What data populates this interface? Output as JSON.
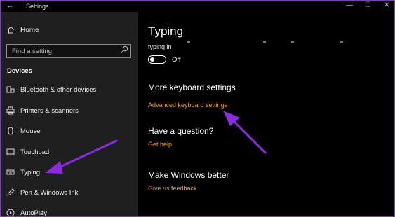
{
  "window": {
    "title": "Settings",
    "back_glyph": "←",
    "minimize_glyph": "—",
    "maximize_glyph": "☐",
    "close_glyph": "✕"
  },
  "sidebar": {
    "home_label": "Home",
    "search_placeholder": "Find a setting",
    "section_title": "Devices",
    "items": [
      {
        "label": "Bluetooth & other devices",
        "icon": "bluetooth-icon"
      },
      {
        "label": "Printers & scanners",
        "icon": "printer-icon"
      },
      {
        "label": "Mouse",
        "icon": "mouse-icon"
      },
      {
        "label": "Touchpad",
        "icon": "touchpad-icon"
      },
      {
        "label": "Typing",
        "icon": "keyboard-icon"
      },
      {
        "label": "Pen & Windows Ink",
        "icon": "pen-icon"
      },
      {
        "label": "AutoPlay",
        "icon": "autoplay-icon"
      }
    ]
  },
  "main": {
    "title": "Typing",
    "typing_setting_label": "typing in",
    "typing_toggle_state": "Off",
    "more_keyboard_heading": "More keyboard settings",
    "advanced_keyboard_link": "Advanced keyboard settings",
    "question_heading": "Have a question?",
    "get_help_link": "Get help",
    "better_heading": "Make Windows better",
    "feedback_link": "Give us feedback"
  },
  "colors": {
    "link": "#e0a43a",
    "sidebar_bg": "#1f1f1f",
    "content_bg": "#000000",
    "annotation_arrow": "#8b2be2"
  }
}
